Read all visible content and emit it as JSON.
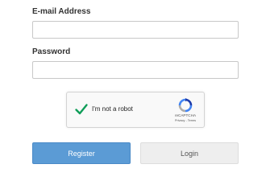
{
  "form": {
    "email_label": "E-mail Address",
    "email_value": "",
    "password_label": "Password",
    "password_value": ""
  },
  "captcha": {
    "checked": true,
    "label": "I'm not a robot",
    "brand": "reCAPTCHA",
    "links": "Privacy - Terms",
    "check_color": "#0f9d58",
    "logo_icon": "recaptcha-logo-icon"
  },
  "buttons": {
    "register_label": "Register",
    "login_label": "Login",
    "register_color": "#5b9bd5",
    "login_color": "#eeeeee"
  }
}
